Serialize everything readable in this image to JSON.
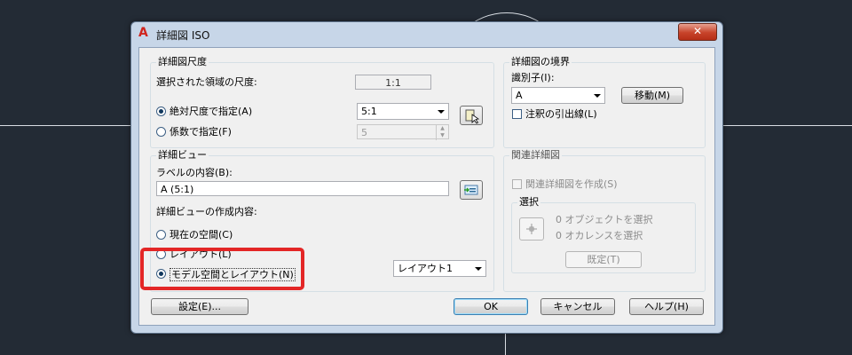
{
  "dialog": {
    "title": "詳細図 ISO",
    "close_label": "✕"
  },
  "scale_group": {
    "title": "詳細図尺度",
    "selected_region_label": "選択された領域の尺度:",
    "selected_region_value": "1:1",
    "absolute_label": "絶対尺度で指定(A)",
    "absolute_value": "5:1",
    "factor_label": "係数で指定(F)",
    "factor_value": "5"
  },
  "boundary_group": {
    "title": "詳細図の境界",
    "identifier_label": "識別子(I):",
    "identifier_value": "A",
    "move_button": "移動(M)",
    "leader_label": "注釈の引出線(L)"
  },
  "view_group": {
    "title": "詳細ビュー",
    "label_content_label": "ラベルの内容(B):",
    "label_content_value": "A (5:1)",
    "creation_label": "詳細ビューの作成内容:",
    "option_current": "現在の空間(C)",
    "option_layout": "レイアウト(L)",
    "option_model_layout": "モデル空間とレイアウト(N)",
    "layout_select_value": "レイアウト1"
  },
  "related_group": {
    "title": "関連詳細図",
    "create_label": "関連詳細図を作成(S)",
    "select_title": "選択",
    "objects_text": "0 オブジェクトを選択",
    "occurrences_text": "0 オカレンスを選択",
    "default_button": "既定(T)"
  },
  "footer": {
    "settings_button": "設定(E)...",
    "ok_button": "OK",
    "cancel_button": "キャンセル",
    "help_button": "ヘルプ(H)"
  },
  "colors": {
    "background": "#232b35",
    "dialog_frame": "#c7d6e8",
    "highlight": "#e32626"
  }
}
